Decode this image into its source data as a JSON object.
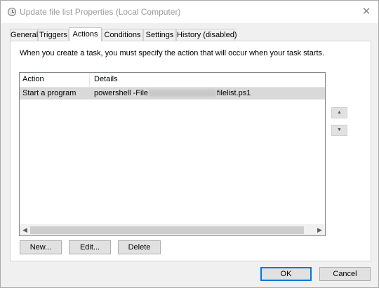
{
  "window": {
    "title": "Update file list Properties (Local Computer)",
    "close_glyph": "✕"
  },
  "tabs": [
    {
      "label": "General",
      "active": false
    },
    {
      "label": "Triggers",
      "active": false
    },
    {
      "label": "Actions",
      "active": true
    },
    {
      "label": "Conditions",
      "active": false
    },
    {
      "label": "Settings",
      "active": false
    },
    {
      "label": "History (disabled)",
      "active": false
    }
  ],
  "actions_tab": {
    "instruction": "When you create a task, you must specify the action that will occur when your task starts.",
    "columns": [
      "Action",
      "Details"
    ],
    "rows": [
      {
        "action": "Start a program",
        "details_prefix": "powershell -File",
        "details_suffix": "filelist.ps1",
        "selected": true
      }
    ],
    "buttons": {
      "new": "New...",
      "edit": "Edit...",
      "delete": "Delete"
    },
    "move_up_glyph": "▲",
    "move_down_glyph": "▼",
    "scroll_left_glyph": "◀",
    "scroll_right_glyph": "▶"
  },
  "dialog_buttons": {
    "ok": "OK",
    "cancel": "Cancel"
  },
  "icons": {
    "title": "task-scheduler-clock-icon",
    "close": "close-icon"
  },
  "colors": {
    "selected_row": "#d9d9d9",
    "default_button_border": "#0078d7"
  }
}
